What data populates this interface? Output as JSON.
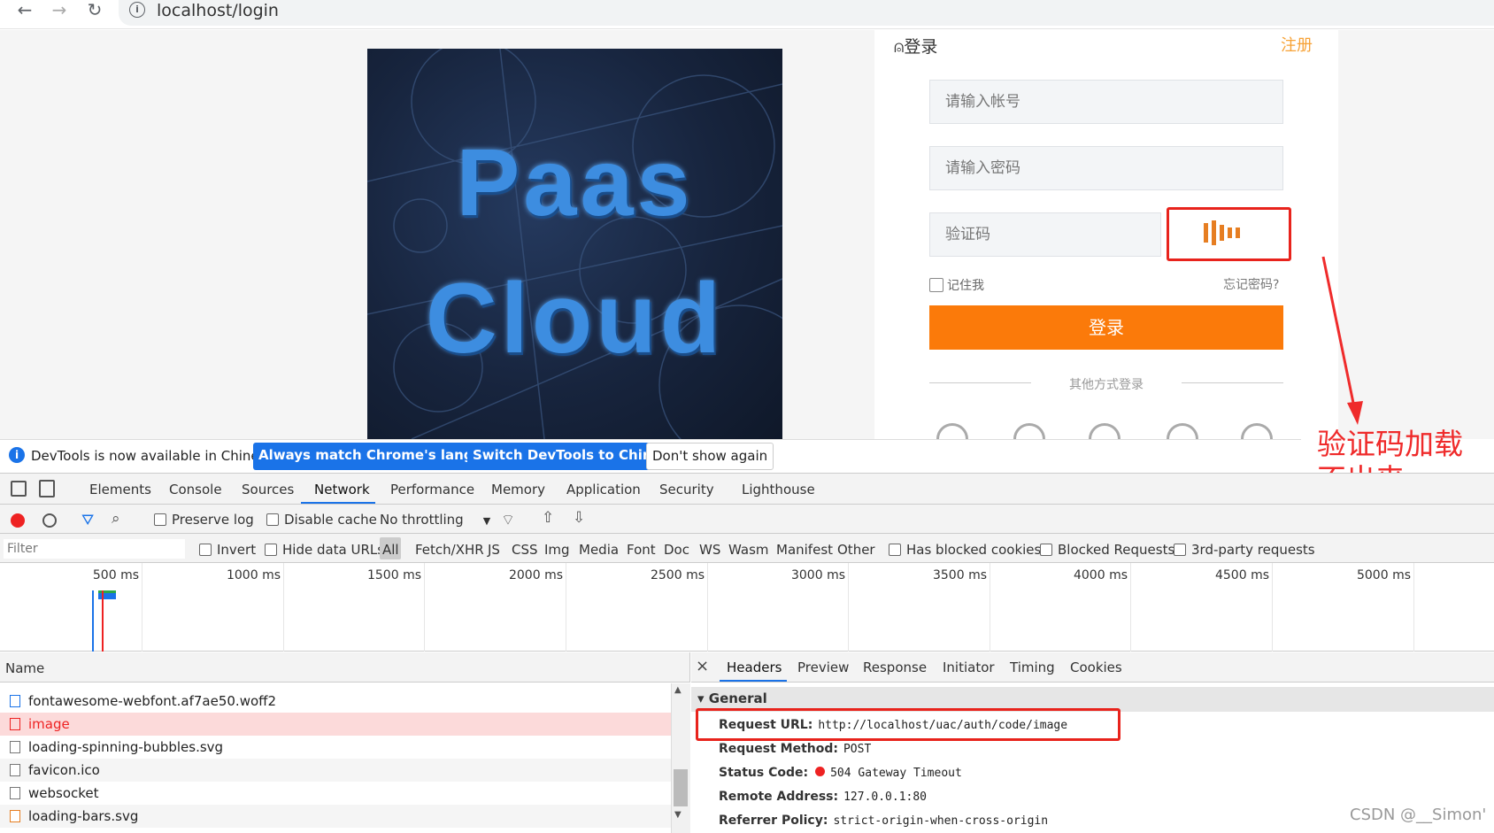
{
  "browser": {
    "url": "localhost/login",
    "back_icon": "arrow-left",
    "forward_icon": "arrow-right",
    "reload_icon": "reload",
    "info_icon": "i"
  },
  "page": {
    "logo": {
      "line1": "Paas",
      "line2": "Cloud"
    },
    "login": {
      "title": "登录",
      "register": "注册",
      "account_placeholder": "请输入帐号",
      "password_placeholder": "请输入密码",
      "captcha_placeholder": "验证码",
      "remember": "记住我",
      "forgot": "忘记密码?",
      "submit": "登录",
      "other_login": "其他方式登录"
    }
  },
  "annotation": {
    "line1": "验证码加载",
    "line2": "不出来",
    "color": "#ef2b2b"
  },
  "banner": {
    "text": "DevTools is now available in Chinese!",
    "btn_match": "Always match Chrome's language",
    "btn_switch": "Switch DevTools to Chinese",
    "btn_dont": "Don't show again"
  },
  "devtools": {
    "tabs": [
      "Elements",
      "Console",
      "Sources",
      "Network",
      "Performance",
      "Memory",
      "Application",
      "Security",
      "Lighthouse"
    ],
    "toolbar": {
      "preserve_log": "Preserve log",
      "disable_cache": "Disable cache",
      "throttling": "No throttling"
    },
    "filter": {
      "placeholder": "Filter",
      "invert": "Invert",
      "hide_data_urls": "Hide data URLs",
      "types": [
        "All",
        "Fetch/XHR",
        "JS",
        "CSS",
        "Img",
        "Media",
        "Font",
        "Doc",
        "WS",
        "Wasm",
        "Manifest",
        "Other"
      ],
      "has_blocked_cookies": "Has blocked cookies",
      "blocked_requests": "Blocked Requests",
      "third_party": "3rd-party requests"
    },
    "timeline": [
      "500 ms",
      "1000 ms",
      "1500 ms",
      "2000 ms",
      "2500 ms",
      "3000 ms",
      "3500 ms",
      "4000 ms",
      "4500 ms",
      "5000 ms"
    ],
    "list": {
      "header": "Name",
      "rows": [
        "fontawesome-webfont.af7ae50.woff2",
        "image",
        "loading-spinning-bubbles.svg",
        "favicon.ico",
        "websocket",
        "loading-bars.svg"
      ]
    },
    "details": {
      "close": "×",
      "tabs": [
        "Headers",
        "Preview",
        "Response",
        "Initiator",
        "Timing",
        "Cookies"
      ],
      "general": "General",
      "fields": [
        {
          "k": "Request URL:",
          "v": "http://localhost/uac/auth/code/image"
        },
        {
          "k": "Request Method:",
          "v": "POST"
        },
        {
          "k": "Status Code:",
          "v": "504 Gateway Timeout"
        },
        {
          "k": "Remote Address:",
          "v": "127.0.0.1:80"
        },
        {
          "k": "Referrer Policy:",
          "v": "strict-origin-when-cross-origin"
        }
      ]
    }
  },
  "watermark": "CSDN @__Simon'"
}
